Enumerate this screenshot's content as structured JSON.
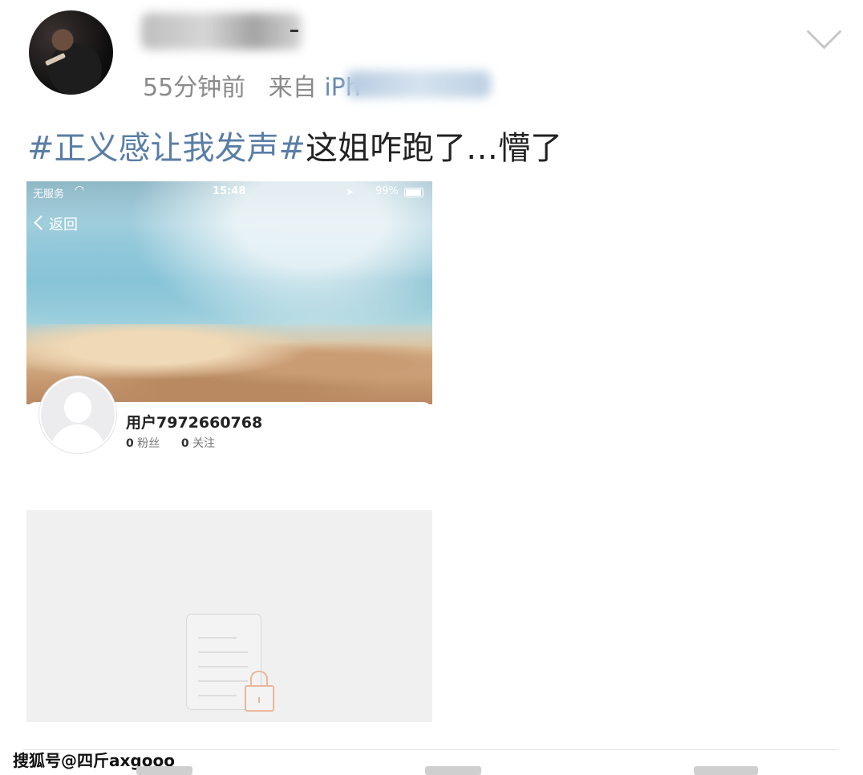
{
  "header": {
    "username_visible": "-",
    "time": "55分钟前",
    "source_prefix": "来自",
    "source_device": "iPh"
  },
  "post": {
    "hashtag": "#正义感让我发声#",
    "text": "这姐咋跑了…懵了"
  },
  "screenshot": {
    "status_bar": {
      "carrier": "无服务",
      "time": "15:48",
      "battery": "99%"
    },
    "back_label": "返回",
    "profile": {
      "username": "用户7972660768",
      "followers_count": "0",
      "followers_label": "粉丝",
      "following_count": "0",
      "following_label": "关注"
    }
  },
  "footer": {
    "watermark": "搜狐号@四斤axgooo"
  },
  "icons": {
    "more": "chevron-down-icon",
    "back": "chevron-left-icon",
    "wifi": "wifi-icon",
    "location": "location-arrow-icon",
    "battery": "battery-icon",
    "locked_doc": "locked-document-icon",
    "default_avatar": "default-avatar-icon"
  },
  "colors": {
    "hashtag": "#5a7ea6",
    "meta": "#8a8a8a",
    "placeholder_bg": "#f0f0f0",
    "lock": "#e9b79b"
  }
}
